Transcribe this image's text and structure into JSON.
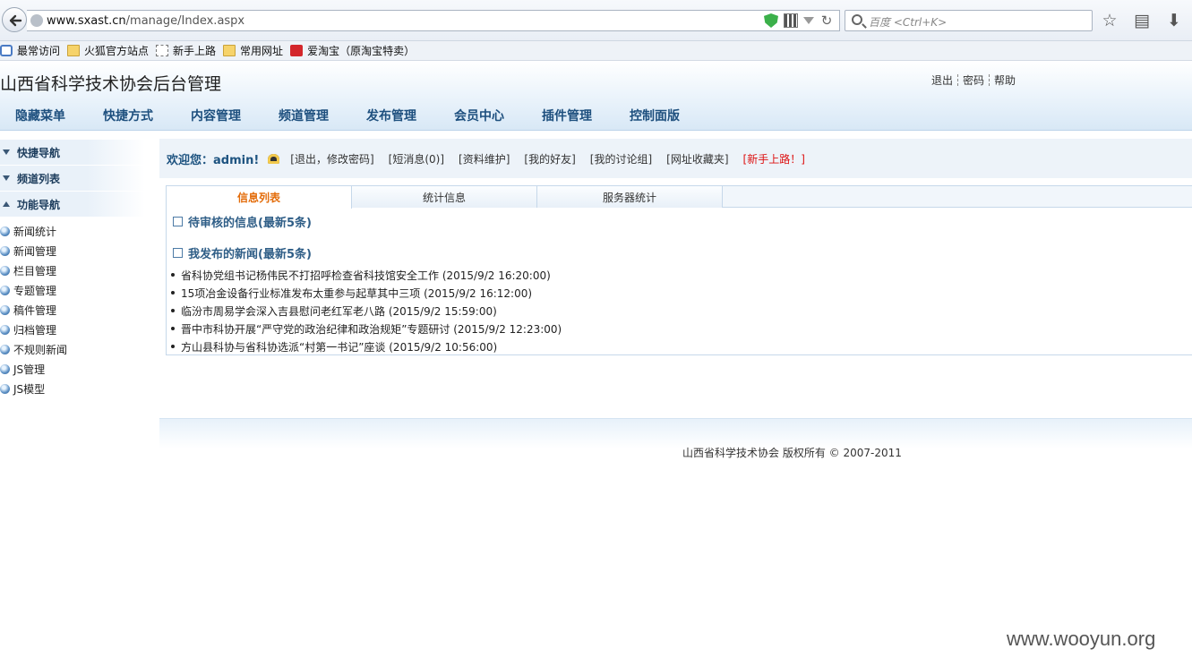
{
  "browser": {
    "url_domain": "www.sxast.cn",
    "url_path": "/manage/Index.aspx",
    "search_placeholder": "百度 <Ctrl+K>",
    "bookmarks": [
      {
        "label": "最常访问",
        "icon": "gear-icon"
      },
      {
        "label": "火狐官方站点",
        "icon": "folder-icon"
      },
      {
        "label": "新手上路",
        "icon": "page-icon"
      },
      {
        "label": "常用网址",
        "icon": "folder-icon"
      },
      {
        "label": "爱淘宝（原淘宝特卖）",
        "icon": "taobao-icon"
      }
    ]
  },
  "header": {
    "title": "山西省科学技术协会后台管理",
    "links": [
      "退出",
      "密码",
      "帮助"
    ]
  },
  "main_menu": [
    "隐藏菜单",
    "快捷方式",
    "内容管理",
    "频道管理",
    "发布管理",
    "会员中心",
    "插件管理",
    "控制面版"
  ],
  "sidebar": {
    "groups": [
      {
        "label": "快捷导航",
        "expanded": false
      },
      {
        "label": "频道列表",
        "expanded": false
      },
      {
        "label": "功能导航",
        "expanded": true
      }
    ],
    "links": [
      "新闻统计",
      "新闻管理",
      "栏目管理",
      "专题管理",
      "稿件管理",
      "归档管理",
      "不规则新闻",
      "JS管理",
      "JS模型"
    ]
  },
  "welcome": {
    "greeting": "欢迎您：admin!",
    "links": [
      "[退出，修改密码]",
      "[短消息(0)]",
      "[资料维护]",
      "[我的好友]",
      "[我的讨论组]",
      "[网址收藏夹]"
    ],
    "newbie_link": "[新手上路！]"
  },
  "tabs": [
    {
      "label": "信息列表",
      "active": true
    },
    {
      "label": "统计信息",
      "active": false
    },
    {
      "label": "服务器统计",
      "active": false
    }
  ],
  "pending": {
    "title": "待审核的信息(最新5条)"
  },
  "published": {
    "title": "我发布的新闻(最新5条)",
    "items": [
      "省科协党组书记杨伟民不打招呼检查省科技馆安全工作 (2015/9/2 16:20:00)",
      "15项冶金设备行业标准发布太重参与起草其中三项 (2015/9/2 16:12:00)",
      "临汾市周易学会深入吉县慰问老红军老八路 (2015/9/2 15:59:00)",
      "晋中市科协开展“严守党的政治纪律和政治规矩”专题研讨 (2015/9/2 12:23:00)",
      "方山县科协与省科协选派“村第一书记”座谈 (2015/9/2 10:56:00)"
    ]
  },
  "footer": {
    "copyright": "山西省科学技术协会 版权所有 © 2007-2011"
  },
  "watermark": "www.wooyun.org"
}
